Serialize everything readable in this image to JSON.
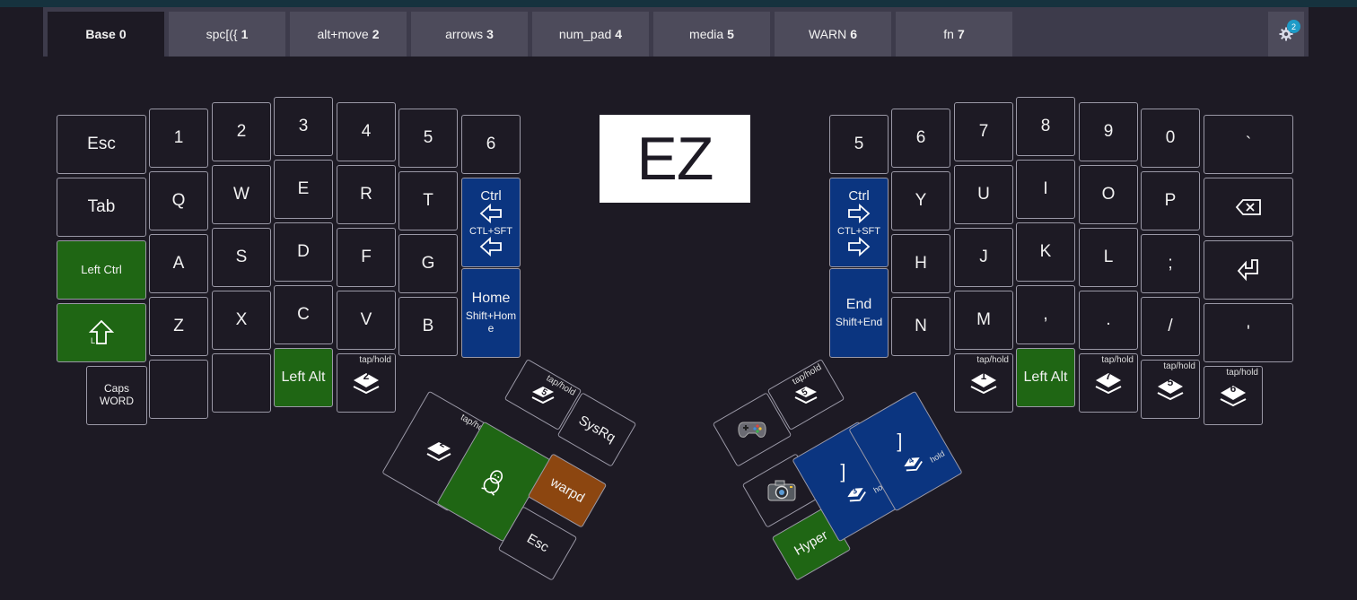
{
  "tabs": [
    {
      "label": "Base",
      "num": "0"
    },
    {
      "label": "spc[({",
      "num": "1"
    },
    {
      "label": "alt+move",
      "num": "2"
    },
    {
      "label": "arrows",
      "num": "3"
    },
    {
      "label": "num_pad",
      "num": "4"
    },
    {
      "label": "media",
      "num": "5"
    },
    {
      "label": "WARN",
      "num": "6"
    },
    {
      "label": "fn",
      "num": "7"
    }
  ],
  "settings": {
    "badge": "2"
  },
  "logo": "EZ",
  "tap_hold": "tap/hold",
  "hold": "hold",
  "left": {
    "r0": [
      "Esc",
      "1",
      "2",
      "3",
      "4",
      "5",
      "6"
    ],
    "r1": [
      "Tab",
      "Q",
      "W",
      "E",
      "R",
      "T"
    ],
    "r1_ctrl": "Ctrl",
    "r1_ctlsft": "CTL+SFT",
    "r2": [
      "Left Ctrl",
      "A",
      "S",
      "D",
      "F",
      "G"
    ],
    "r2_home": "Home",
    "r2_home_sub": "Shift+Home",
    "r3": [
      "Z",
      "X",
      "C",
      "V",
      "B"
    ],
    "shift_sub": "L",
    "r4_caps": "Caps WORD",
    "r4_alt": "Left Alt",
    "r4_layer": "2"
  },
  "right": {
    "r0": [
      "5",
      "6",
      "7",
      "8",
      "9",
      "0",
      "`"
    ],
    "r1_ctrl": "Ctrl",
    "r1_ctlsft": "CTL+SFT",
    "r1": [
      "Y",
      "U",
      "I",
      "O",
      "P"
    ],
    "r2": [
      "H",
      "J",
      "K",
      "L",
      ";"
    ],
    "r2_end": "End",
    "r2_end_sub": "Shift+End",
    "r3": [
      "N",
      "M",
      ",",
      ".",
      "/",
      "'"
    ],
    "r4_alt": "Left Alt",
    "r4_layers": [
      "1",
      "7",
      "5",
      "6"
    ]
  },
  "thumb_left": {
    "layer_a": "5",
    "layer_b": "2",
    "sysrq": "SysRq",
    "warpd": "warpd",
    "esc": "Esc"
  },
  "thumb_right": {
    "layer_a": "5",
    "hyper": "Hyper",
    "bracket_label": "]",
    "layer_c": "3",
    "layer_d": "4"
  }
}
